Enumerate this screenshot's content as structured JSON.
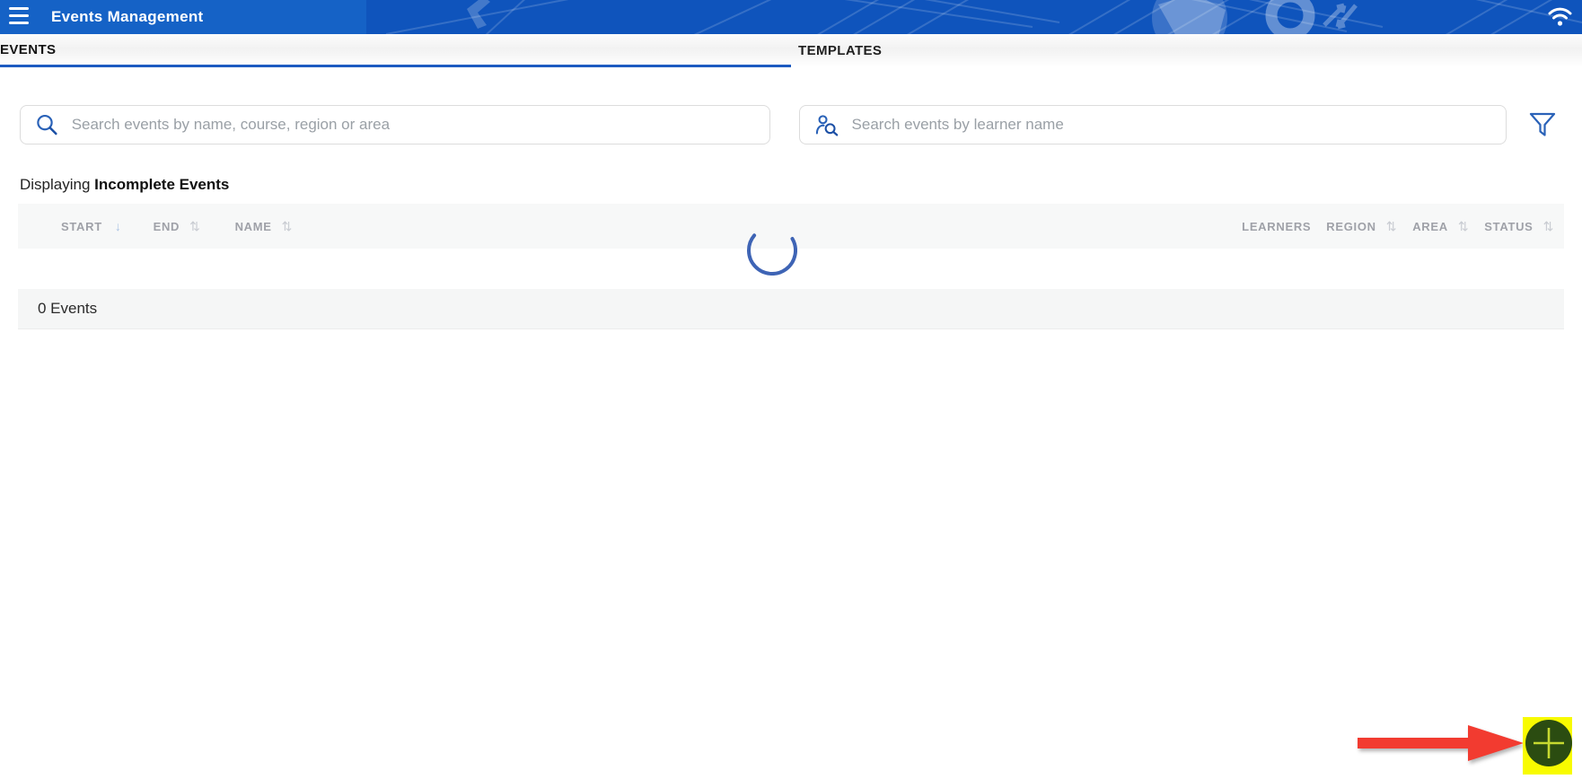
{
  "app_bar": {
    "title": "Events Management",
    "background_color": "#0f54bc",
    "left_block_color": "#1562c6",
    "icons": {
      "menu": "hamburger-menu-icon",
      "wifi": "wifi-icon"
    }
  },
  "tabs": [
    {
      "label": "EVENTS",
      "active": true
    },
    {
      "label": "TEMPLATES",
      "active": false
    }
  ],
  "search": {
    "event_search_placeholder": "Search events by name, course, region or area",
    "learner_search_placeholder": "Search events by learner name",
    "search_icon": "magnifier-icon",
    "learner_icon": "person-search-icon",
    "filter_icon": "funnel-icon",
    "icon_color": "#2a62b8"
  },
  "status_line": {
    "prefix": "Displaying ",
    "highlight": "Incomplete Events"
  },
  "table": {
    "columns": [
      {
        "label": "START",
        "sort": "desc"
      },
      {
        "label": "END",
        "sort": "both"
      },
      {
        "label": "NAME",
        "sort": "both"
      },
      {
        "label": "LEARNERS",
        "sort": "none"
      },
      {
        "label": "REGION",
        "sort": "both"
      },
      {
        "label": "AREA",
        "sort": "both"
      },
      {
        "label": "STATUS",
        "sort": "both"
      }
    ],
    "rows": [],
    "loading": true,
    "spinner_color": "#3e64b5",
    "footer_count": "0 Events"
  },
  "icons": {
    "sort_desc": "↓",
    "sort_both": "⇅"
  },
  "fab": {
    "name": "add-event-button",
    "circle_color": "#2b4c11",
    "plus_color": "#c6d930"
  },
  "annotation": {
    "type": "red-arrow-pointing-to-add-button",
    "arrow_color": "#f23b30",
    "highlight_color": "#f8fb00"
  }
}
